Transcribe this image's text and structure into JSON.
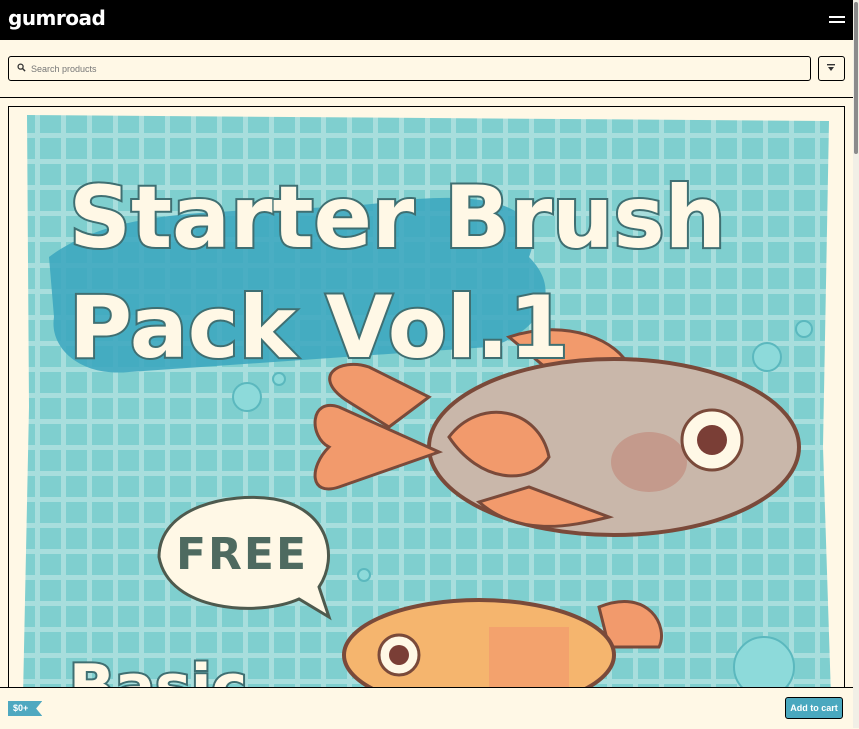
{
  "header": {
    "logo_text": "gumroad",
    "menu_icon": "hamburger-menu-icon"
  },
  "search": {
    "placeholder": "Search products",
    "value": "",
    "icon": "search-icon"
  },
  "filter": {
    "icon": "filter-icon"
  },
  "product": {
    "cover_title_line1": "Starter Brush",
    "cover_title_line2": "Pack Vol.1",
    "cover_badge": "FREE",
    "cover_bottom_text": "Basic"
  },
  "purchase": {
    "price": "$0+",
    "add_to_cart_label": "Add to cart"
  },
  "colors": {
    "header_bg": "#000000",
    "page_bg": "#fff8e6",
    "accent": "#4aa8bf",
    "cover_bg": "#7fcfcf"
  }
}
